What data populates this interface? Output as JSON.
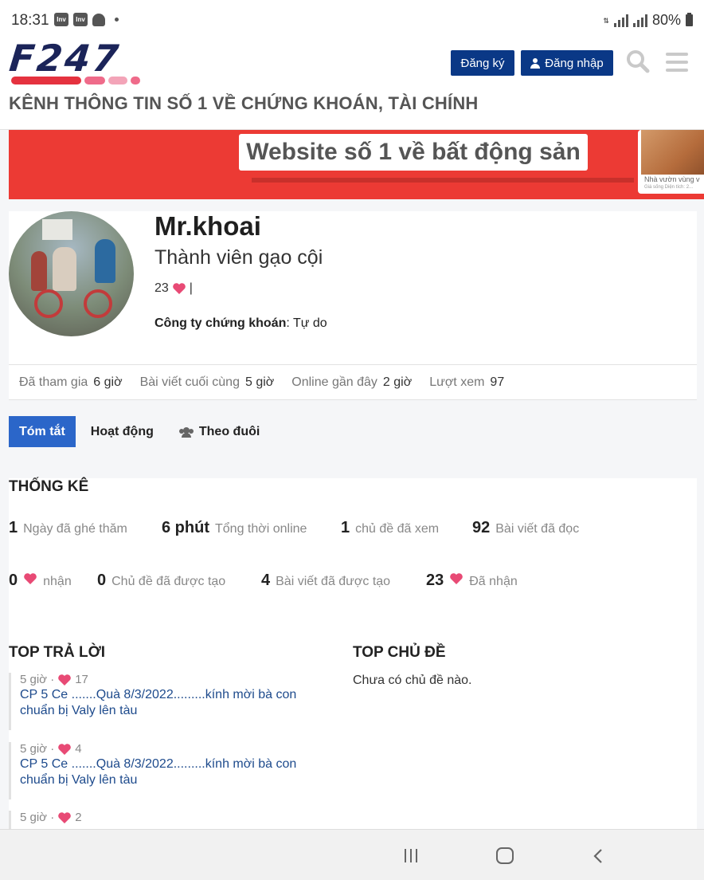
{
  "status_bar": {
    "time": "18:31",
    "app_icons": [
      "Inv",
      "Inv"
    ],
    "battery": "80%"
  },
  "header": {
    "logo_text": "F247",
    "logo_bar_colors": [
      "#e5323f",
      "#ef6b8a",
      "#f3a4b8",
      "#f3a4b8"
    ],
    "register_label": "Đăng ký",
    "login_label": "Đăng nhập",
    "tagline": "KÊNH THÔNG TIN SỐ 1 VỀ CHỨNG KHOÁN, TÀI CHÍNH"
  },
  "banner": {
    "headline": "Website số 1 về bất động sản",
    "card_caption": "Nhà vườn vùng v",
    "card_subcaption": "Giá sống   Diện tích: 2..."
  },
  "profile": {
    "name": "Mr.khoai",
    "rank": "Thành viên gạo cội",
    "likes": "23",
    "separator": "|",
    "company_label": "Công ty chứng khoán",
    "company_value": ": Tự do"
  },
  "stats": [
    {
      "label": "Đã tham gia",
      "value": "6 giờ"
    },
    {
      "label": "Bài viết cuối cùng",
      "value": "5 giờ"
    },
    {
      "label": "Online gần đây",
      "value": "2 giờ"
    },
    {
      "label": "Lượt xem",
      "value": "97"
    }
  ],
  "tabs": [
    {
      "label": "Tóm tắt",
      "active": true
    },
    {
      "label": "Hoạt động",
      "active": false
    },
    {
      "label": "Theo đuôi",
      "active": false
    }
  ],
  "summary": {
    "title": "THỐNG KÊ",
    "metrics_row1": [
      {
        "num": "1",
        "label": "Ngày đã ghé thăm"
      },
      {
        "num": "6 phút",
        "label": "Tổng thời online"
      },
      {
        "num": "1",
        "label": "chủ đề đã xem"
      },
      {
        "num": "92",
        "label": "Bài viết đã đọc"
      }
    ],
    "metrics_row2": [
      {
        "num": "0",
        "label": "nhận",
        "heart": true
      },
      {
        "num": "0",
        "label": "Chủ đề đã được tạo",
        "heart": false
      },
      {
        "num": "4",
        "label": "Bài viết đã được tạo",
        "heart": false
      },
      {
        "num": "23",
        "label": "Đã nhận",
        "heart": true
      }
    ]
  },
  "top_replies": {
    "title": "TOP TRẢ LỜI",
    "items": [
      {
        "time": "5 giờ ·",
        "likes": "17",
        "title": "CP 5 Ce .......Quà 8/3/2022.........kính mời bà con chuẩn bị Valy lên tàu"
      },
      {
        "time": "5 giờ ·",
        "likes": "4",
        "title": "CP 5 Ce .......Quà 8/3/2022.........kính mời bà con chuẩn bị Valy lên tàu"
      },
      {
        "time": "5 giờ ·",
        "likes": "2",
        "title": ""
      }
    ]
  },
  "top_topics": {
    "title": "TOP CHỦ ĐỀ",
    "empty_text": "Chưa có chủ đề nào."
  },
  "colors": {
    "brand_navy": "#1b2459",
    "button_blue": "#0a3886",
    "active_tab": "#2b66c9",
    "heart": "#e84a75",
    "link": "#1d4a8c",
    "banner_red": "#ec3a34"
  }
}
